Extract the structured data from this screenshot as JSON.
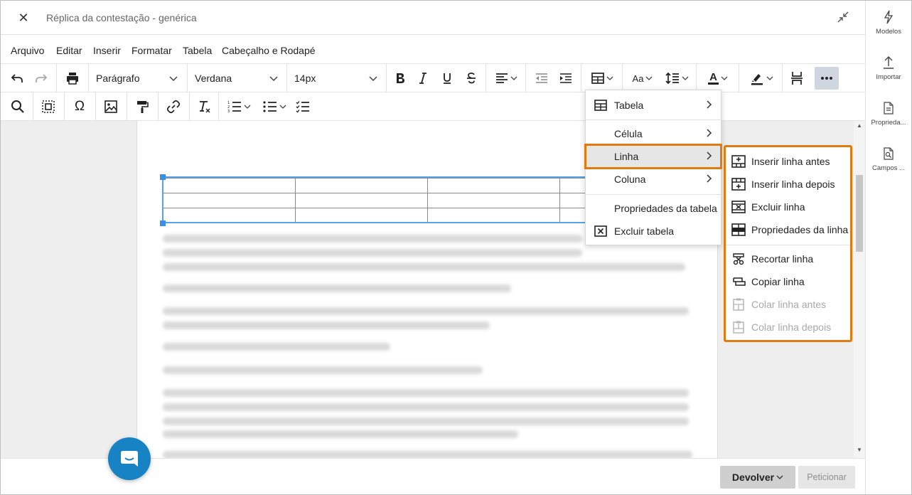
{
  "window": {
    "title": "Réplica da contestação - genérica"
  },
  "rail": {
    "items": [
      {
        "label": "Modelos",
        "icon": "lightning-icon"
      },
      {
        "label": "Importar",
        "icon": "upload-icon"
      },
      {
        "label": "Proprieda...",
        "icon": "document-properties-icon"
      },
      {
        "label": "Campos ...",
        "icon": "document-search-icon"
      }
    ]
  },
  "menubar": {
    "items": [
      "Arquivo",
      "Editar",
      "Inserir",
      "Formatar",
      "Tabela",
      "Cabeçalho e Rodapé"
    ]
  },
  "toolbar": {
    "block_format": "Parágrafo",
    "font_family": "Verdana",
    "font_size": "14px",
    "font_case_label": "Aa",
    "text_color_label": "A"
  },
  "table_menu": {
    "items": [
      "Tabela",
      "Célula",
      "Linha",
      "Coluna",
      "Propriedades da tabela",
      "Excluir tabela"
    ]
  },
  "row_submenu": {
    "items": [
      {
        "label": "Inserir linha antes",
        "enabled": true
      },
      {
        "label": "Inserir linha depois",
        "enabled": true
      },
      {
        "label": "Excluir linha",
        "enabled": true
      },
      {
        "label": "Propriedades da linha",
        "enabled": true
      },
      {
        "label": "Recortar linha",
        "enabled": true
      },
      {
        "label": "Copiar linha",
        "enabled": true
      },
      {
        "label": "Colar linha antes",
        "enabled": false
      },
      {
        "label": "Colar linha depois",
        "enabled": false
      }
    ]
  },
  "footer": {
    "devolver_label": "Devolver",
    "peticionar_label": "Peticionar"
  },
  "colors": {
    "highlight": "#e07b12",
    "selection": "#3b8ee8",
    "chat": "#1782c4"
  }
}
